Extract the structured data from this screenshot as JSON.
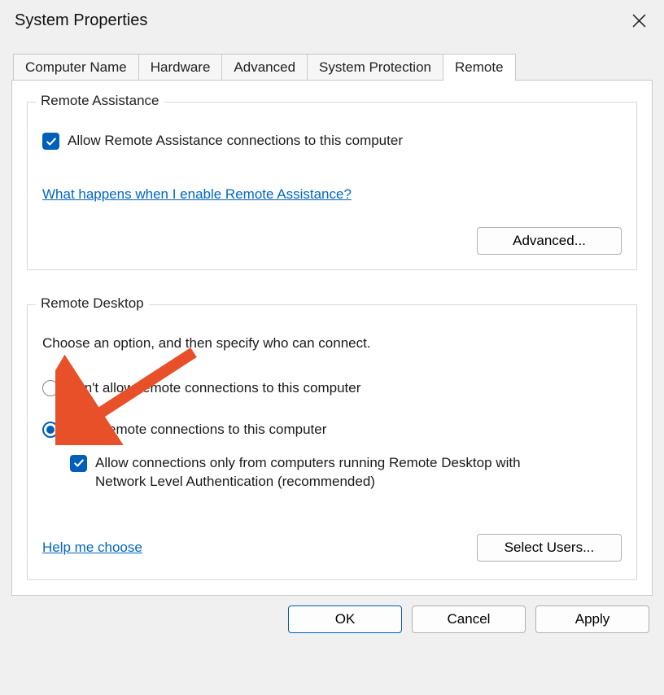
{
  "window": {
    "title": "System Properties"
  },
  "tabs": [
    "Computer Name",
    "Hardware",
    "Advanced",
    "System Protection",
    "Remote"
  ],
  "active_tab_index": 4,
  "remote_assistance": {
    "legend": "Remote Assistance",
    "allow_label": "Allow Remote Assistance connections to this computer",
    "allow_checked": true,
    "help_link": "What happens when I enable Remote Assistance?",
    "advanced_button": "Advanced..."
  },
  "remote_desktop": {
    "legend": "Remote Desktop",
    "intro": "Choose an option, and then specify who can connect.",
    "option_deny": "Don't allow remote connections to this computer",
    "option_allow": "Allow remote connections to this computer",
    "selected_option": "allow",
    "nla_label": "Allow connections only from computers running Remote Desktop with Network Level Authentication (recommended)",
    "nla_checked": true,
    "help_link": "Help me choose",
    "select_users_button": "Select Users..."
  },
  "footer": {
    "ok": "OK",
    "cancel": "Cancel",
    "apply": "Apply"
  }
}
